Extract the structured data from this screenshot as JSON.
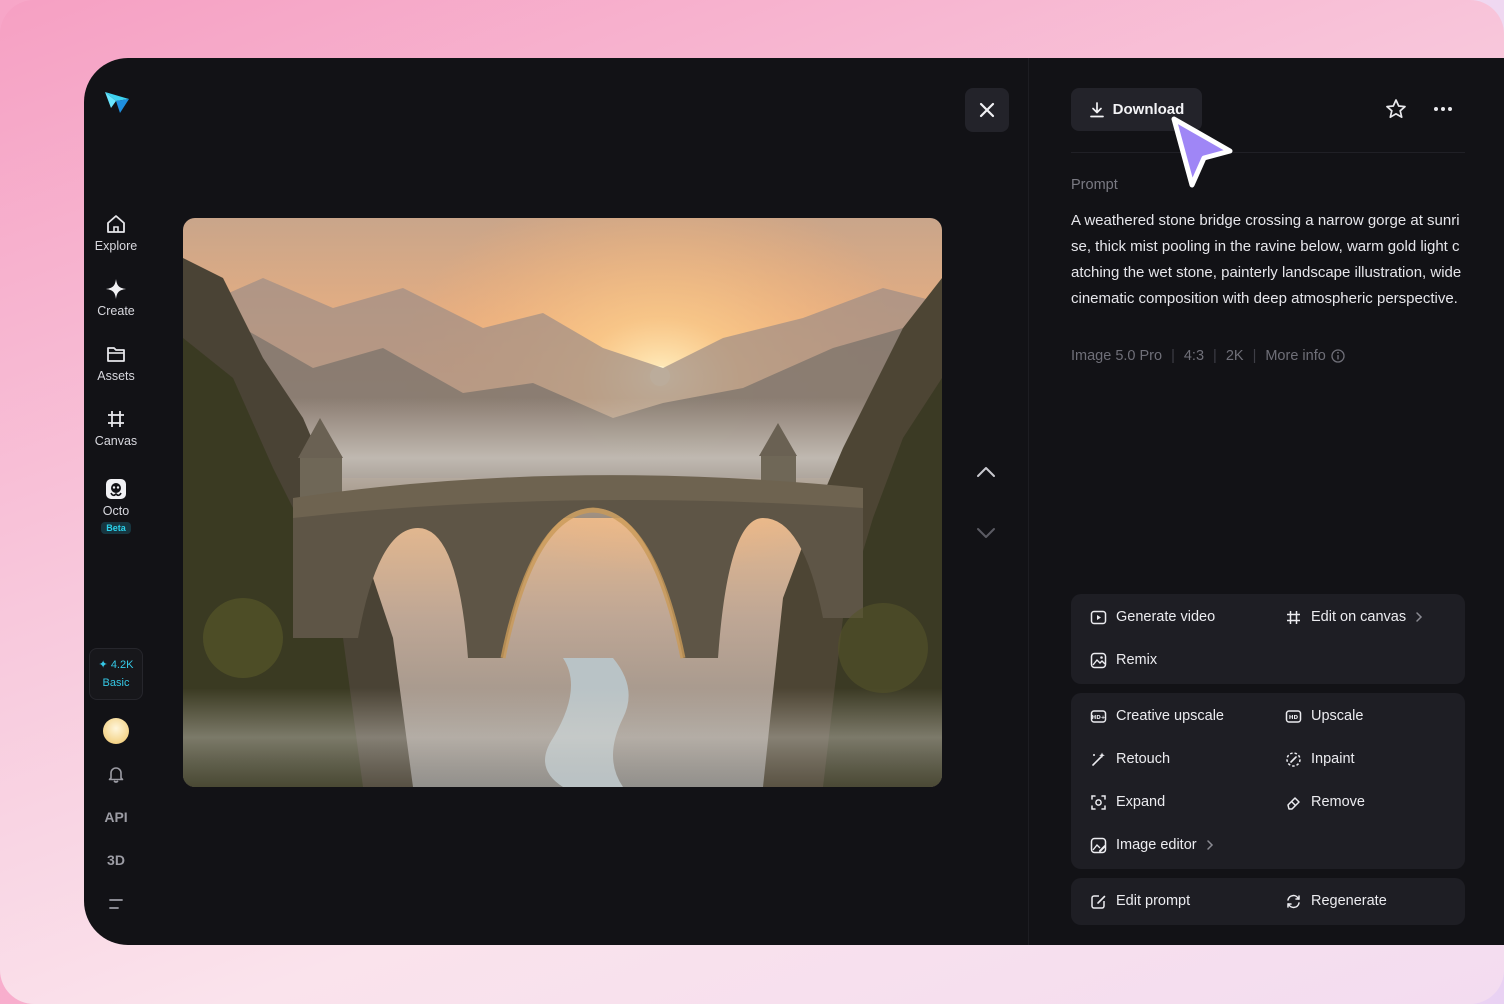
{
  "sidebar": {
    "items": [
      {
        "label": "Explore",
        "icon": "home-icon"
      },
      {
        "label": "Create",
        "icon": "sparkle-icon"
      },
      {
        "label": "Assets",
        "icon": "folder-icon"
      },
      {
        "label": "Canvas",
        "icon": "grid-frame-icon"
      },
      {
        "label": "Octo",
        "icon": "octo-icon",
        "badge": "Beta"
      }
    ],
    "credits": {
      "amount": "4.2K",
      "plan": "Basic"
    },
    "api_label": "API",
    "threed_label": "3D"
  },
  "toolbar": {
    "download_label": "Download"
  },
  "prompt": {
    "label": "Prompt",
    "text": "A weathered stone bridge crossing a narrow gorge at sunrise, thick mist pooling in the ravine below, warm gold light catching the wet stone, painterly landscape illustration, wide cinematic composition with deep atmospheric perspective.",
    "model": "Image 5.0 Pro",
    "ratio": "4:3",
    "resolution": "2K",
    "more_info": "More info"
  },
  "actions": {
    "generate_video": "Generate video",
    "edit_on_canvas": "Edit on canvas",
    "remix": "Remix",
    "creative_upscale": "Creative upscale",
    "upscale": "Upscale",
    "retouch": "Retouch",
    "inpaint": "Inpaint",
    "expand": "Expand",
    "remove": "Remove",
    "image_editor": "Image editor",
    "edit_prompt": "Edit prompt",
    "regenerate": "Regenerate"
  },
  "colors": {
    "accent": "#35c8e6",
    "cursor": "#a78bfa",
    "panel": "#121216",
    "card": "#1e1e24"
  }
}
